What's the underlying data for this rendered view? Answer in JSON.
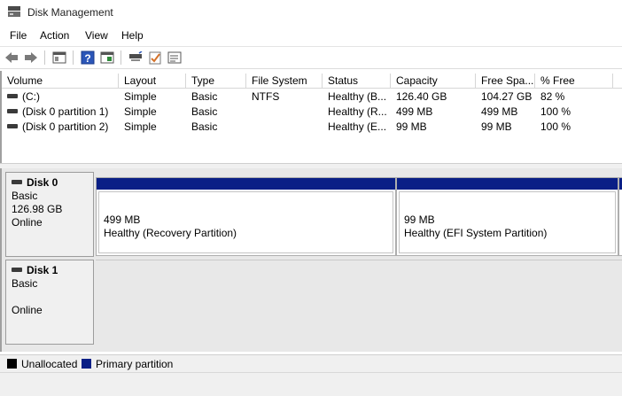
{
  "window": {
    "title": "Disk Management",
    "icon": "disk-management-icon"
  },
  "menu": [
    "File",
    "Action",
    "View",
    "Help"
  ],
  "toolbar": {
    "buttons": [
      "back-arrow-icon",
      "forward-arrow-icon",
      "console-tree-icon",
      "help-icon",
      "properties-icon",
      "connect-icon",
      "check-icon",
      "list-icon"
    ]
  },
  "volume_table": {
    "columns": [
      "Volume",
      "Layout",
      "Type",
      "File System",
      "Status",
      "Capacity",
      "Free Spa...",
      "% Free"
    ],
    "rows": [
      {
        "volume": "(C:)",
        "layout": "Simple",
        "type": "Basic",
        "file_system": "NTFS",
        "status": "Healthy (B...",
        "capacity": "126.40 GB",
        "free": "104.27 GB",
        "pct_free": "82 %"
      },
      {
        "volume": "(Disk 0 partition 1)",
        "layout": "Simple",
        "type": "Basic",
        "file_system": "",
        "status": "Healthy (R...",
        "capacity": "499 MB",
        "free": "499 MB",
        "pct_free": "100 %"
      },
      {
        "volume": "(Disk 0 partition 2)",
        "layout": "Simple",
        "type": "Basic",
        "file_system": "",
        "status": "Healthy (E...",
        "capacity": "99 MB",
        "free": "99 MB",
        "pct_free": "100 %"
      }
    ]
  },
  "disks": [
    {
      "name": "Disk 0",
      "type": "Basic",
      "size": "126.98 GB",
      "state": "Online",
      "partitions": [
        {
          "size": "499 MB",
          "status": "Healthy (Recovery Partition)"
        },
        {
          "size": "99 MB",
          "status": "Healthy (EFI System Partition)"
        }
      ]
    },
    {
      "name": "Disk 1",
      "type": "Basic",
      "size": "",
      "state": "Online",
      "partitions": []
    }
  ],
  "legend": [
    {
      "label": "Unallocated",
      "color": "#000000"
    },
    {
      "label": "Primary partition",
      "color": "#0a1f86"
    }
  ]
}
